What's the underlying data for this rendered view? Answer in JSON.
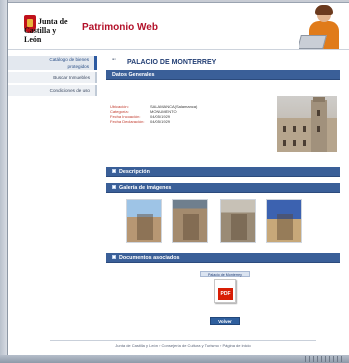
{
  "header": {
    "logo_line1": "Junta de",
    "logo_line2": "Castilla y León",
    "portal_title": "Patrimonio Web"
  },
  "sidebar": {
    "items": [
      {
        "label_line1": "Catálogo de bienes",
        "label_line2": "protegidos",
        "active": true
      },
      {
        "label_line1": "Buscar Inmuebles",
        "label_line2": "",
        "active": false
      },
      {
        "label_line1": "Condiciones de uso",
        "label_line2": "",
        "active": false
      }
    ]
  },
  "main": {
    "page_title": "PALACIO DE MONTERREY",
    "datos": {
      "section_title": "Datos Generales",
      "rows": [
        {
          "key": "Ubicación:",
          "value": "SALAMANCA(Salamanca)"
        },
        {
          "key": "Categoría:",
          "value": "MONUMENTO"
        },
        {
          "key": "Fecha Incoación:",
          "value": "04/05/1929"
        },
        {
          "key": "Fecha Declaración:",
          "value": "04/05/1929"
        }
      ]
    },
    "descripcion_title": "Descripción",
    "galeria_title": "Galería de imágenes",
    "documentos": {
      "section_title": "Documentos asociados",
      "doc_label": "Palacio de Monterrey",
      "pdf_label": "PDF"
    },
    "volver_label": "Volver"
  },
  "footer": {
    "text": "Junta de Castilla y León › Consejería de Cultura y Turismo › Página de inicio"
  }
}
